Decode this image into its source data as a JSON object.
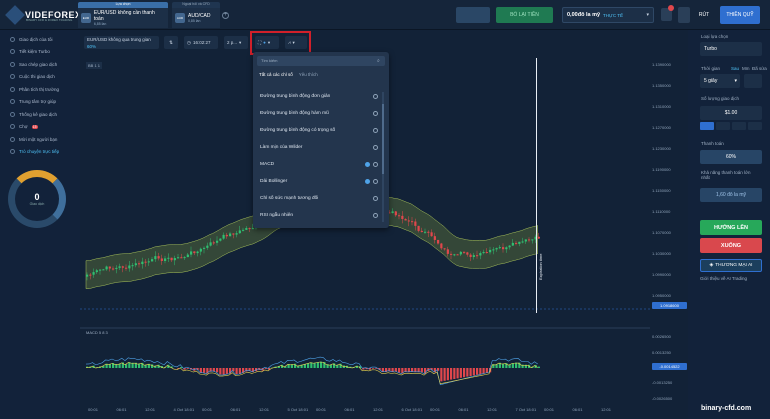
{
  "logo": {
    "name": "VIDEFOREX",
    "tagline": "BINARY CFD & FOREX TRADING"
  },
  "tabs": [
    {
      "head": "Lựa chọn",
      "icon": "EUR",
      "name": "EUR/USD không cần thanh toán",
      "pct": "6,85 lần"
    },
    {
      "head": "Ngoại hối và CFD",
      "icon": "AUD",
      "name": "AUD/CAD",
      "pct": "0,85 lần"
    }
  ],
  "header": {
    "deposit": "BỔ LẠI TIỀN",
    "balance_amount": "0,00đô la mỹ",
    "balance_type": "THỰC TẾ",
    "withdraw": "RÚT",
    "exit": "THIỀN QUỸ"
  },
  "sidebar": {
    "items": [
      {
        "label": "Giao dịch của tôi",
        "active": false
      },
      {
        "label": "Tiết kiệm Turbo",
        "active": false
      },
      {
        "label": "Sao chép giao dịch",
        "active": false
      },
      {
        "label": "Cuộc thi giao dịch",
        "active": false
      },
      {
        "label": "Phân tích thị trường",
        "active": false
      },
      {
        "label": "Trung tâm trợ giúp",
        "active": false
      },
      {
        "label": "Thống kê giao dịch",
        "active": false
      },
      {
        "label": "Chợ",
        "badge": "15",
        "active": false
      },
      {
        "label": "Mời một người bạn",
        "active": false
      },
      {
        "label": "Trò chuyện trực tiếp",
        "active": true
      }
    ],
    "gauge_value": "0",
    "gauge_label": "Giao dịch"
  },
  "toolbar": {
    "pair": "EUR/USD không qua trung gian",
    "pct": "60%",
    "time": "16:02:27",
    "period": "2 p..."
  },
  "dropdown": {
    "search_placeholder": "Tìm kiếm",
    "tab_all": "Tất cả các chỉ số",
    "tab_fav": "Yêu thích",
    "items": [
      {
        "label": "Đường trung bình động đơn giản",
        "info": false
      },
      {
        "label": "Đường trung bình động hàm mũ",
        "info": false
      },
      {
        "label": "Đường trung bình động có trọng số",
        "info": false
      },
      {
        "label": "Làm mịn của Wilder",
        "info": false
      },
      {
        "label": "MACD",
        "info": true
      },
      {
        "label": "Dải Bollinger",
        "info": true
      },
      {
        "label": "Chỉ số sức mạnh tương đối",
        "info": false
      },
      {
        "label": "RSI ngẫu nhiên",
        "info": false
      }
    ]
  },
  "chart": {
    "legend_main": "BB 1 1",
    "legend_macd": "MACD 5 8 3",
    "expiration_label": "Expiration time",
    "price_ticks": [
      "1.1390000",
      "1.1350000",
      "1.1310000",
      "1.1270000",
      "1.1230000",
      "1.1190000",
      "1.1150000",
      "1.1110000",
      "1.1070000",
      "1.1030000",
      "1.0990000",
      "1.0950000"
    ],
    "current_price": "1.0918600",
    "macd_ticks": [
      "0.0026500",
      "0.0013250",
      "-0.0013250",
      "-0.0026500"
    ],
    "macd_current": "-0.0014522",
    "time_ticks": [
      "00:01",
      "06:01",
      "12:01",
      "4 Oct 18:01",
      "00:01",
      "06:01",
      "12:01",
      "5 Oct 18:01",
      "00:01",
      "06:01",
      "12:01",
      "6 Oct 18:01",
      "00:01",
      "06:01",
      "12:01",
      "7 Oct 18:01",
      "00:01",
      "06:01",
      "12:01"
    ]
  },
  "right": {
    "type_label": "Loại lựa chọn",
    "type_value": "Turbo",
    "time_label": "Thời gian",
    "time_units": [
      "Sau",
      "Mm",
      "Đã sửa"
    ],
    "time_value": "5 giây",
    "amount_label": "Số lượng giao dịch",
    "amount_value": "$1.00",
    "payout_label": "Thanh toán",
    "payout_value": "60%",
    "payout_cap_label": "Khả năng thanh toán lớn nhất",
    "payout_cap_value": "1,60 đô la mỹ",
    "up": "HƯỚNG LÊN",
    "down": "XUỐNG",
    "ai": "THƯƠNG MẠI AI",
    "ai_intro": "Giới thiệu về AI Trading"
  },
  "watermark": "binary-cfd.com"
}
